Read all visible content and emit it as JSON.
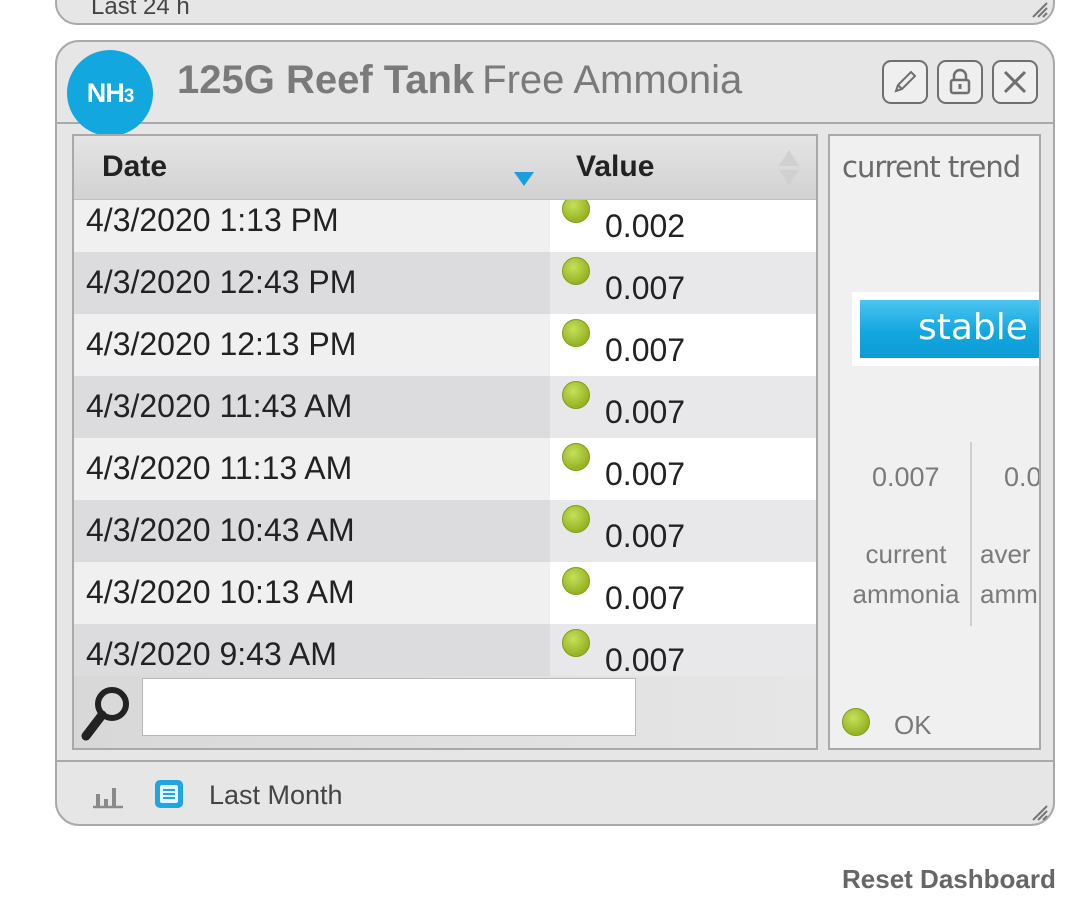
{
  "previous_widget": {
    "range_label": "Last 24 h"
  },
  "widget": {
    "badge": {
      "main": "NH",
      "sub": "3"
    },
    "tank_name": "125G Reef Tank",
    "parameter": "Free Ammonia",
    "colors": {
      "accent": "#13a7e0",
      "status_ok": "#a3c73a",
      "panel_bg": "#e6e6e6",
      "border": "#a9a9a9"
    },
    "buttons": {
      "edit_icon": "pencil-icon",
      "lock_icon": "lock-icon",
      "close_icon": "close-icon"
    },
    "table": {
      "columns": [
        "Date",
        "Value"
      ],
      "sort": {
        "column": "Date",
        "direction": "descending"
      },
      "rows": [
        {
          "date": "4/3/2020 1:13 PM",
          "value": "0.002",
          "status": "ok"
        },
        {
          "date": "4/3/2020 12:43 PM",
          "value": "0.007",
          "status": "ok"
        },
        {
          "date": "4/3/2020 12:13 PM",
          "value": "0.007",
          "status": "ok"
        },
        {
          "date": "4/3/2020 11:43 AM",
          "value": "0.007",
          "status": "ok"
        },
        {
          "date": "4/3/2020 11:13 AM",
          "value": "0.007",
          "status": "ok"
        },
        {
          "date": "4/3/2020 10:43 AM",
          "value": "0.007",
          "status": "ok"
        },
        {
          "date": "4/3/2020 10:13 AM",
          "value": "0.007",
          "status": "ok"
        },
        {
          "date": "4/3/2020 9:43 AM",
          "value": "0.007",
          "status": "ok"
        }
      ],
      "search": {
        "value": "",
        "placeholder": ""
      }
    },
    "trend": {
      "title": "current trend",
      "state": "stable",
      "stats": [
        {
          "value": "0.007",
          "label_line1": "current",
          "label_line2": "ammonia"
        },
        {
          "value": "0.0",
          "label_line1": "aver",
          "label_line2": "amm"
        }
      ],
      "status_text": "OK"
    },
    "footer": {
      "range_label": "Last Month"
    }
  },
  "reset_label": "Reset Dashboard"
}
